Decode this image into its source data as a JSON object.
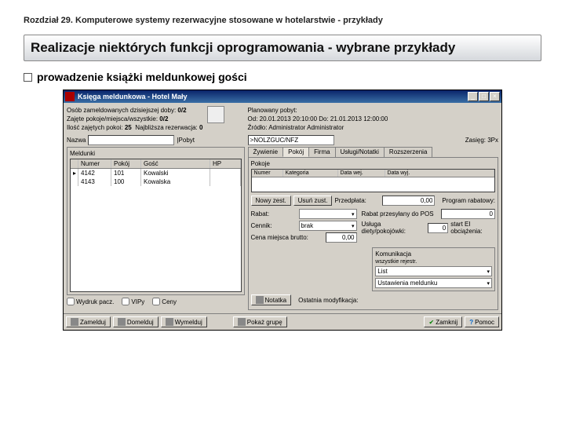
{
  "chapter": "Rozdział 29. Komputerowe systemy rezerwacyjne stosowane w hotelarstwie - przykłady",
  "title": "Realizacje niektórych funkcji oprogramowania - wybrane przykłady",
  "subtitle": "prowadzenie książki meldunkowej gości",
  "window": {
    "title": "Księga meldunkowa - Hotel Mały",
    "info": {
      "line1": "Osób zameldowanych dzisiejszej doby:",
      "val1": "0/2",
      "line2": "Zajęte pokoje/miejsca/wszystkie:",
      "val2": "0/2",
      "line3a_lbl": "Ilość zajętych pokoi:",
      "line3a_val": "25",
      "line3b_lbl": "Najbliższa rezerwacja:",
      "line3b_val": "0"
    },
    "right_info": {
      "plan_lbl": "Planowany pobyt:",
      "od": "Od: 20.01.2013   20:10:00   Do: 21.01.2013   12:00:00",
      "zrodlo": "Źródło: Administrator Administrator"
    },
    "status": {
      "code_lbl": ">NOLZGUC/NFZ",
      "zasieg": "Zasięg: 3Px"
    },
    "search": {
      "nazwa_lbl": "Nazwa",
      "pobyt_lbl": "|Pobyt"
    },
    "left_panel": {
      "title": "Meldunki",
      "cols": [
        "",
        "Numer",
        "Pokój",
        "Gość",
        "HP"
      ],
      "rows": [
        [
          "",
          "4142",
          "101",
          "Kowalski",
          ""
        ],
        [
          "",
          "4143",
          "100",
          "Kowalska",
          ""
        ]
      ]
    },
    "tabs": [
      "Żywienie",
      "Pokój",
      "Firma",
      "Usługi/Notatki",
      "Rozszerzenia"
    ],
    "pokoj_panel": {
      "title": "Pokoje",
      "cols": [
        "Numer",
        "Kategoria",
        "Data wej.",
        "Data wyj."
      ]
    },
    "mid_buttons": [
      "Nowy zest.",
      "Usuń zust.",
      "Przedpłata:"
    ],
    "przedplata_val": "0,00",
    "prog_lbl": "Program rabatowy:",
    "rabat_lbl": "Rabat:",
    "rabat_pos_lbl": "Rabat przesyłany do POS",
    "rabat_pos_val": "0",
    "cennik_lbl": "Cennik:",
    "cennik_val": "brak",
    "startclean_lbl": "Usługa diety/pokojówki:",
    "startclean_val": "0",
    "clean_lbl": "start EI obciążenia:",
    "cena_brutto_lbl": "Cena miejsca brutto:",
    "cena_brutto_val": "0,00",
    "kom_title": "Komunikacja",
    "kom_sub": "wszystkie rejestr.",
    "list_lbl": "List",
    "ust_lbl": "Ustawienia meldunku",
    "last_mod": "Ostatnia modyfikacja:",
    "checks": {
      "a": "Wydruk pacz.",
      "b": "VIPy",
      "c": "Ceny"
    },
    "foot": {
      "zamelduj": "Zamelduj",
      "domelduj": "Domelduj",
      "wymelduj": "Wymelduj",
      "notatka": "Notatka",
      "pokaz": "Pokaż grupę",
      "zamknij": "Zamknij",
      "pomoc": "Pomoc"
    }
  }
}
